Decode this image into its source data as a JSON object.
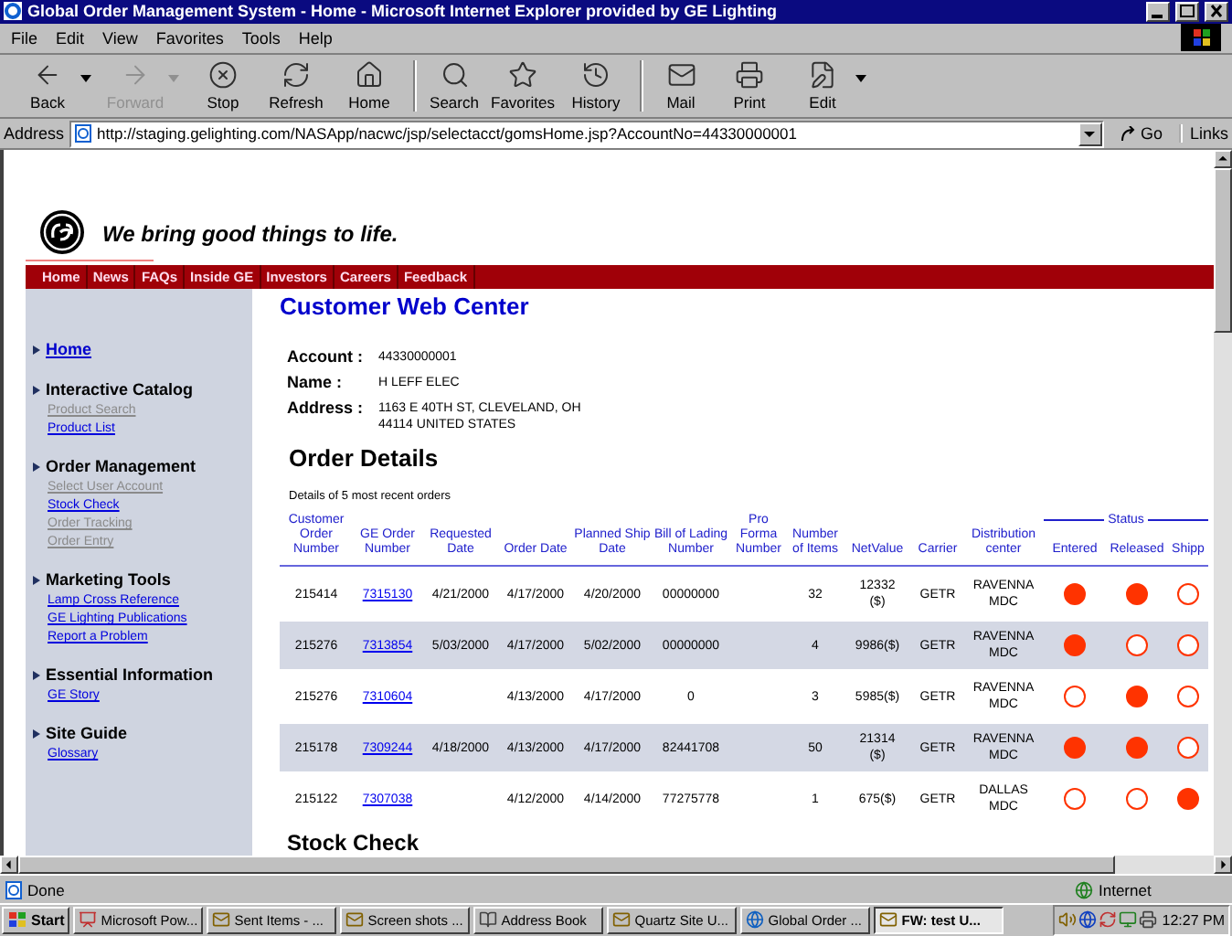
{
  "window": {
    "title": "Global Order Management System - Home - Microsoft Internet Explorer provided by GE Lighting"
  },
  "menu": [
    "File",
    "Edit",
    "View",
    "Favorites",
    "Tools",
    "Help"
  ],
  "toolbar": [
    {
      "kind": "back",
      "label": "Back",
      "disabled": false,
      "dropdown": true,
      "sep_before": false
    },
    {
      "kind": "forward",
      "label": "Forward",
      "disabled": true,
      "dropdown": true,
      "sep_before": false
    },
    {
      "kind": "stop",
      "label": "Stop",
      "disabled": false,
      "dropdown": false,
      "sep_before": false
    },
    {
      "kind": "refresh",
      "label": "Refresh",
      "disabled": false,
      "dropdown": false,
      "sep_before": false
    },
    {
      "kind": "home",
      "label": "Home",
      "disabled": false,
      "dropdown": false,
      "sep_before": false
    },
    {
      "kind": "search",
      "label": "Search",
      "disabled": false,
      "dropdown": false,
      "sep_before": true
    },
    {
      "kind": "favorites",
      "label": "Favorites",
      "disabled": false,
      "dropdown": false,
      "sep_before": false
    },
    {
      "kind": "history",
      "label": "History",
      "disabled": false,
      "dropdown": false,
      "sep_before": false
    },
    {
      "kind": "mail",
      "label": "Mail",
      "disabled": false,
      "dropdown": false,
      "sep_before": true
    },
    {
      "kind": "print",
      "label": "Print",
      "disabled": false,
      "dropdown": false,
      "sep_before": false
    },
    {
      "kind": "edit",
      "label": "Edit",
      "disabled": false,
      "dropdown": true,
      "sep_before": false
    }
  ],
  "address": {
    "label": "Address",
    "value": "http://staging.gelighting.com/NASApp/nacwc/jsp/selectacct/gomsHome.jsp?AccountNo=44330000001",
    "go": "Go",
    "links": "Links"
  },
  "site": {
    "tagline": "We bring good things to life.",
    "nav": [
      "Home",
      "News",
      "FAQs",
      "Inside GE",
      "Investors",
      "Careers",
      "Feedback"
    ],
    "sidebar": [
      {
        "heading": "Home",
        "kind": "link"
      },
      {
        "heading": "Interactive Catalog",
        "kind": "group",
        "links": [
          {
            "label": "Product Search",
            "disabled": true
          },
          {
            "label": "Product List",
            "disabled": false
          }
        ]
      },
      {
        "heading": "Order Management",
        "kind": "group",
        "links": [
          {
            "label": "Select User Account",
            "disabled": true
          },
          {
            "label": "Stock Check",
            "disabled": false
          },
          {
            "label": "Order Tracking",
            "disabled": true
          },
          {
            "label": "Order Entry",
            "disabled": true
          }
        ]
      },
      {
        "heading": "Marketing Tools",
        "kind": "group",
        "links": [
          {
            "label": "Lamp Cross Reference",
            "disabled": false
          },
          {
            "label": "GE Lighting Publications",
            "disabled": false
          },
          {
            "label": "Report a Problem",
            "disabled": false
          }
        ]
      },
      {
        "heading": "Essential Information",
        "kind": "group",
        "links": [
          {
            "label": "GE Story",
            "disabled": false
          }
        ]
      },
      {
        "heading": "Site Guide",
        "kind": "group",
        "links": [
          {
            "label": "Glossary",
            "disabled": false
          }
        ]
      }
    ]
  },
  "main": {
    "title": "Customer Web Center",
    "account": [
      {
        "label": "Account :",
        "lines": [
          "44330000001"
        ]
      },
      {
        "label": "Name :",
        "lines": [
          "H LEFF ELEC"
        ]
      },
      {
        "label": "Address :",
        "lines": [
          "1163 E 40TH ST, CLEVELAND, OH",
          "44114 UNITED STATES"
        ]
      }
    ],
    "orders_title": "Order Details",
    "caption": "Details of 5 most recent orders",
    "status_label": "Status",
    "columns": [
      "Customer Order Number",
      "GE Order Number",
      "Requested Date",
      "Order Date",
      "Planned Ship Date",
      "Bill of Lading Number",
      "Pro Forma Number",
      "Number of Items",
      "NetValue",
      "Carrier",
      "Distribution center",
      "Entered",
      "Released",
      "Shipp"
    ],
    "rows": [
      {
        "customer_order": "215414",
        "ge_order": "7315130",
        "requested": "4/21/2000",
        "order_date": "4/17/2000",
        "ship_date": "4/20/2000",
        "bill": "00000000",
        "items": "32",
        "net_value": [
          "12332",
          "($)"
        ],
        "carrier": "GETR",
        "center": "RAVENNA MDC",
        "entered": true,
        "released": true,
        "shipped": false
      },
      {
        "customer_order": "215276",
        "ge_order": "7313854",
        "requested": "5/03/2000",
        "order_date": "4/17/2000",
        "ship_date": "5/02/2000",
        "bill": "00000000",
        "items": "4",
        "net_value": [
          "9986($)"
        ],
        "carrier": "GETR",
        "center": "RAVENNA MDC",
        "entered": true,
        "released": false,
        "shipped": false
      },
      {
        "customer_order": "215276",
        "ge_order": "7310604",
        "order_date": "4/13/2000",
        "ship_date": "4/17/2000",
        "bill": "0",
        "items": "3",
        "net_value": [
          "5985($)"
        ],
        "carrier": "GETR",
        "center": "RAVENNA MDC",
        "entered": false,
        "released": true,
        "shipped": false
      },
      {
        "customer_order": "215178",
        "ge_order": "7309244",
        "requested": "4/18/2000",
        "order_date": "4/13/2000",
        "ship_date": "4/17/2000",
        "bill": "82441708",
        "items": "50",
        "net_value": [
          "21314",
          "($)"
        ],
        "carrier": "GETR",
        "center": "RAVENNA MDC",
        "entered": true,
        "released": true,
        "shipped": false
      },
      {
        "customer_order": "215122",
        "ge_order": "7307038",
        "order_date": "4/12/2000",
        "ship_date": "4/14/2000",
        "bill": "77275778",
        "items": "1",
        "net_value": [
          "675($)"
        ],
        "carrier": "GETR",
        "center": "DALLAS MDC",
        "entered": false,
        "released": false,
        "shipped": true
      }
    ],
    "stock_title": "Stock Check"
  },
  "status_bar": {
    "text": "Done",
    "zone": "Internet"
  },
  "taskbar": {
    "start": "Start",
    "items": [
      {
        "kind": "app",
        "label": "Microsoft Pow...",
        "selected": false
      },
      {
        "kind": "mail",
        "label": "Sent Items - ...",
        "selected": false
      },
      {
        "kind": "mail",
        "label": "Screen shots ...",
        "selected": false
      },
      {
        "kind": "book",
        "label": "Address Book",
        "selected": false
      },
      {
        "kind": "mail",
        "label": "Quartz Site U...",
        "selected": false
      },
      {
        "kind": "browser",
        "label": "Global Order ...",
        "selected": false
      },
      {
        "kind": "mail",
        "label": "FW: test U...",
        "selected": true
      }
    ],
    "clock": "12:27 PM"
  }
}
